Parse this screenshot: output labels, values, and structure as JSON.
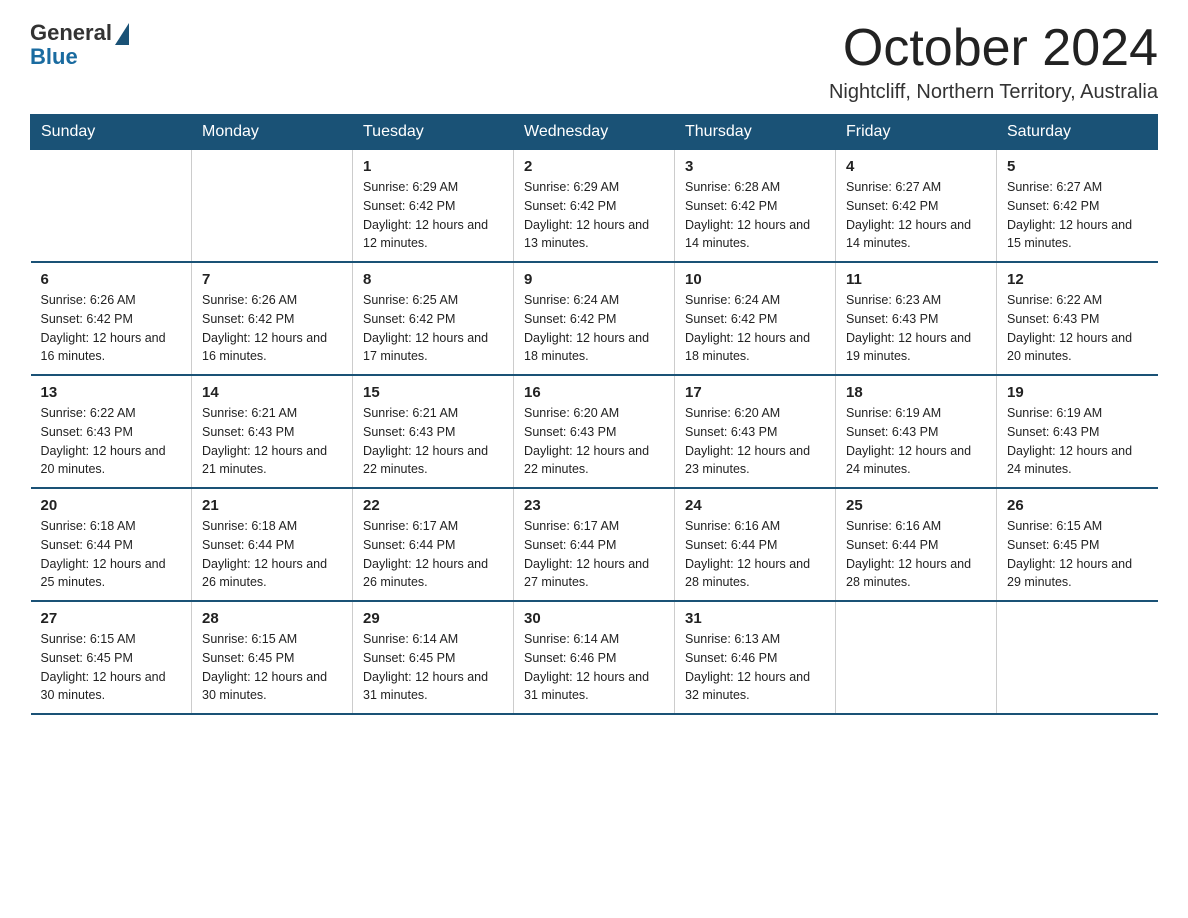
{
  "logo": {
    "general": "General",
    "blue": "Blue"
  },
  "header": {
    "month": "October 2024",
    "location": "Nightcliff, Northern Territory, Australia"
  },
  "days_of_week": [
    "Sunday",
    "Monday",
    "Tuesday",
    "Wednesday",
    "Thursday",
    "Friday",
    "Saturday"
  ],
  "weeks": [
    [
      {
        "day": "",
        "info": ""
      },
      {
        "day": "",
        "info": ""
      },
      {
        "day": "1",
        "info": "Sunrise: 6:29 AM\nSunset: 6:42 PM\nDaylight: 12 hours and 12 minutes."
      },
      {
        "day": "2",
        "info": "Sunrise: 6:29 AM\nSunset: 6:42 PM\nDaylight: 12 hours and 13 minutes."
      },
      {
        "day": "3",
        "info": "Sunrise: 6:28 AM\nSunset: 6:42 PM\nDaylight: 12 hours and 14 minutes."
      },
      {
        "day": "4",
        "info": "Sunrise: 6:27 AM\nSunset: 6:42 PM\nDaylight: 12 hours and 14 minutes."
      },
      {
        "day": "5",
        "info": "Sunrise: 6:27 AM\nSunset: 6:42 PM\nDaylight: 12 hours and 15 minutes."
      }
    ],
    [
      {
        "day": "6",
        "info": "Sunrise: 6:26 AM\nSunset: 6:42 PM\nDaylight: 12 hours and 16 minutes."
      },
      {
        "day": "7",
        "info": "Sunrise: 6:26 AM\nSunset: 6:42 PM\nDaylight: 12 hours and 16 minutes."
      },
      {
        "day": "8",
        "info": "Sunrise: 6:25 AM\nSunset: 6:42 PM\nDaylight: 12 hours and 17 minutes."
      },
      {
        "day": "9",
        "info": "Sunrise: 6:24 AM\nSunset: 6:42 PM\nDaylight: 12 hours and 18 minutes."
      },
      {
        "day": "10",
        "info": "Sunrise: 6:24 AM\nSunset: 6:42 PM\nDaylight: 12 hours and 18 minutes."
      },
      {
        "day": "11",
        "info": "Sunrise: 6:23 AM\nSunset: 6:43 PM\nDaylight: 12 hours and 19 minutes."
      },
      {
        "day": "12",
        "info": "Sunrise: 6:22 AM\nSunset: 6:43 PM\nDaylight: 12 hours and 20 minutes."
      }
    ],
    [
      {
        "day": "13",
        "info": "Sunrise: 6:22 AM\nSunset: 6:43 PM\nDaylight: 12 hours and 20 minutes."
      },
      {
        "day": "14",
        "info": "Sunrise: 6:21 AM\nSunset: 6:43 PM\nDaylight: 12 hours and 21 minutes."
      },
      {
        "day": "15",
        "info": "Sunrise: 6:21 AM\nSunset: 6:43 PM\nDaylight: 12 hours and 22 minutes."
      },
      {
        "day": "16",
        "info": "Sunrise: 6:20 AM\nSunset: 6:43 PM\nDaylight: 12 hours and 22 minutes."
      },
      {
        "day": "17",
        "info": "Sunrise: 6:20 AM\nSunset: 6:43 PM\nDaylight: 12 hours and 23 minutes."
      },
      {
        "day": "18",
        "info": "Sunrise: 6:19 AM\nSunset: 6:43 PM\nDaylight: 12 hours and 24 minutes."
      },
      {
        "day": "19",
        "info": "Sunrise: 6:19 AM\nSunset: 6:43 PM\nDaylight: 12 hours and 24 minutes."
      }
    ],
    [
      {
        "day": "20",
        "info": "Sunrise: 6:18 AM\nSunset: 6:44 PM\nDaylight: 12 hours and 25 minutes."
      },
      {
        "day": "21",
        "info": "Sunrise: 6:18 AM\nSunset: 6:44 PM\nDaylight: 12 hours and 26 minutes."
      },
      {
        "day": "22",
        "info": "Sunrise: 6:17 AM\nSunset: 6:44 PM\nDaylight: 12 hours and 26 minutes."
      },
      {
        "day": "23",
        "info": "Sunrise: 6:17 AM\nSunset: 6:44 PM\nDaylight: 12 hours and 27 minutes."
      },
      {
        "day": "24",
        "info": "Sunrise: 6:16 AM\nSunset: 6:44 PM\nDaylight: 12 hours and 28 minutes."
      },
      {
        "day": "25",
        "info": "Sunrise: 6:16 AM\nSunset: 6:44 PM\nDaylight: 12 hours and 28 minutes."
      },
      {
        "day": "26",
        "info": "Sunrise: 6:15 AM\nSunset: 6:45 PM\nDaylight: 12 hours and 29 minutes."
      }
    ],
    [
      {
        "day": "27",
        "info": "Sunrise: 6:15 AM\nSunset: 6:45 PM\nDaylight: 12 hours and 30 minutes."
      },
      {
        "day": "28",
        "info": "Sunrise: 6:15 AM\nSunset: 6:45 PM\nDaylight: 12 hours and 30 minutes."
      },
      {
        "day": "29",
        "info": "Sunrise: 6:14 AM\nSunset: 6:45 PM\nDaylight: 12 hours and 31 minutes."
      },
      {
        "day": "30",
        "info": "Sunrise: 6:14 AM\nSunset: 6:46 PM\nDaylight: 12 hours and 31 minutes."
      },
      {
        "day": "31",
        "info": "Sunrise: 6:13 AM\nSunset: 6:46 PM\nDaylight: 12 hours and 32 minutes."
      },
      {
        "day": "",
        "info": ""
      },
      {
        "day": "",
        "info": ""
      }
    ]
  ]
}
